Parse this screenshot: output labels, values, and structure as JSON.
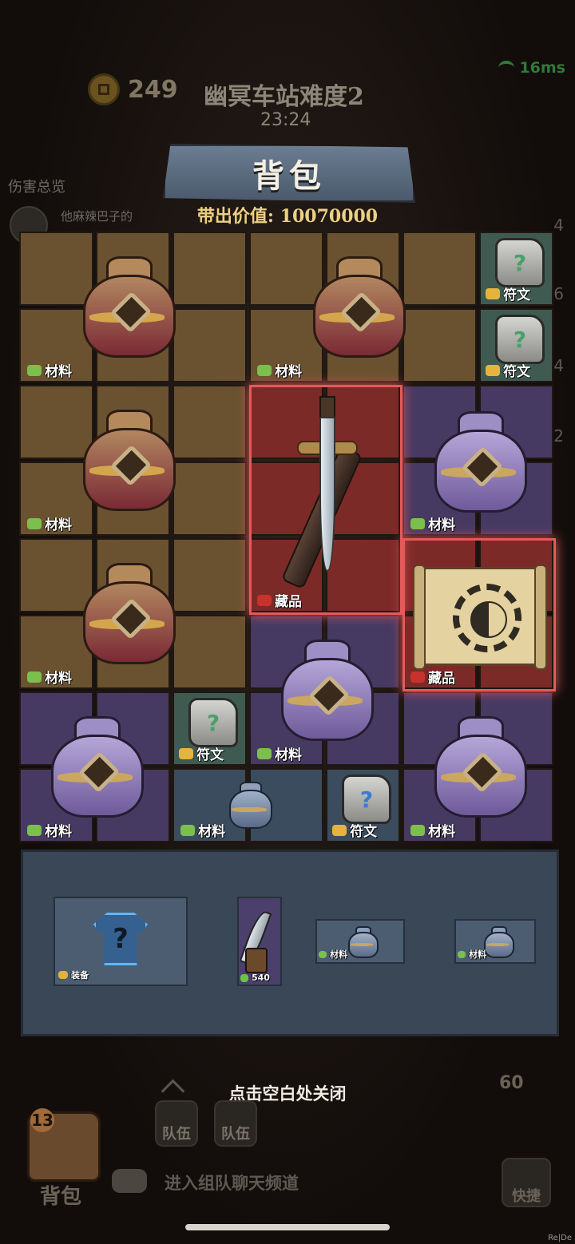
{
  "hud": {
    "coins": "249",
    "stage_title": "幽冥车站难度2",
    "timer": "23:24",
    "ping": "16ms"
  },
  "damage_panel": {
    "title": "伤害总览",
    "player_name": "他麻辣巴子的"
  },
  "side_numbers": [
    "4",
    "6",
    "4",
    "2"
  ],
  "backpack_panel": {
    "title": "背包",
    "carry_value": "带出价值: 10070000"
  },
  "items": {
    "material": "材料",
    "rune": "符文",
    "collectible": "藏品",
    "equipment": "装备"
  },
  "rune_mark": "?",
  "tray": {
    "dagger_value": "540"
  },
  "hint": "点击空白处关闭",
  "bottom": {
    "backpack_count": "13",
    "backpack_label": "背包",
    "team_label_1": "队伍",
    "team_label_2": "队伍",
    "chat_text": "进入组队聊天频道",
    "quick_label": "快捷",
    "energy": "60"
  },
  "corner_text": "Re|De",
  "colors": {
    "brown_cell": "#6a5230",
    "purple_cell": "#463a63",
    "green_cell": "#3f5b51",
    "red_cell": "#7c2a28",
    "gold_text": "#ecd083"
  }
}
